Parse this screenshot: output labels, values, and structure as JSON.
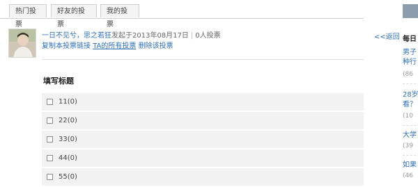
{
  "tabs": [
    "热门投票",
    "好友的投票",
    "我的投票"
  ],
  "poll_meta": {
    "author": "一日不见兮，思之若狂",
    "created_text": "发起于2013年08月17日",
    "votes_text": "0人投票",
    "copy_link": "复制本投票链接",
    "all_polls_link": "TA的所有投票",
    "delete_link": "删除该投票"
  },
  "back_link": "<<返回",
  "poll": {
    "title": "填写标题",
    "options": [
      "11(0)",
      "22(0)",
      "33(0)",
      "44(0)",
      "55(0)"
    ]
  },
  "sidebar": {
    "heading": "每日",
    "items": [
      {
        "line1": "男子",
        "line2": "种行",
        "count": "(86"
      },
      {
        "line1": "28岁",
        "line2": "看？",
        "count": "(10"
      },
      {
        "line1": "大学",
        "line2": "",
        "count": "(39"
      },
      {
        "line1": "如果",
        "line2": "",
        "count": "(46"
      }
    ]
  }
}
